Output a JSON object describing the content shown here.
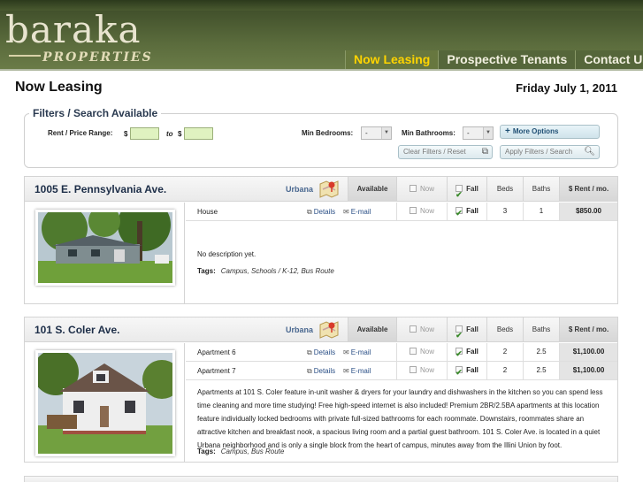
{
  "brand": {
    "logo": "baraka",
    "tagline": "PROPERTIES"
  },
  "nav": [
    {
      "label": "Now Leasing",
      "active": true
    },
    {
      "label": "Prospective Tenants",
      "active": false
    },
    {
      "label": "Contact Us",
      "active": false
    }
  ],
  "page": {
    "title": "Now Leasing",
    "date": "Friday July 1, 2011"
  },
  "filters": {
    "legend": "Filters / Search Available",
    "rent_label": "Rent / Price Range:",
    "currency": "$",
    "to": "to",
    "min_bed_label": "Min Bedrooms:",
    "min_bed_value": "-",
    "min_bath_label": "Min Bathrooms:",
    "min_bath_value": "-",
    "more_options": "More Options",
    "clear": "Clear Filters / Reset",
    "apply": "Apply Filters / Search"
  },
  "columns": {
    "available": "Available",
    "now": "Now",
    "fall": "Fall",
    "beds": "Beds",
    "baths": "Baths",
    "rent": "$ Rent / mo."
  },
  "links": {
    "details": "Details",
    "email": "E-mail"
  },
  "properties": [
    {
      "address": "1005 E. Pennsylvania Ave.",
      "city": "Urbana",
      "units": [
        {
          "name": "House",
          "now": "Now",
          "fall": "Fall",
          "beds": "3",
          "baths": "1",
          "rent": "$850.00"
        }
      ],
      "description": "No description yet.",
      "tags_label": "Tags:",
      "tags": "Campus, Schools / K-12, Bus Route"
    },
    {
      "address": "101 S. Coler Ave.",
      "city": "Urbana",
      "units": [
        {
          "name": "Apartment 6",
          "now": "Now",
          "fall": "Fall",
          "beds": "2",
          "baths": "2.5",
          "rent": "$1,100.00"
        },
        {
          "name": "Apartment 7",
          "now": "Now",
          "fall": "Fall",
          "beds": "2",
          "baths": "2.5",
          "rent": "$1,100.00"
        }
      ],
      "description": "Apartments at 101 S. Coler feature in-unit washer & dryers for your laundry and dishwashers in the kitchen so you can spend less time cleaning and more time studying! Free high-speed internet is also included! Premium 2BR/2.5BA apartments at this location feature individually locked bedrooms with private full-sized bathrooms for each roommate. Downstairs, roommates share an attractive kitchen and breakfast nook, a spacious living room and a partial guest bathroom. 101 S. Coler Ave. is located in a quiet Urbana neighborhood and is only a single block from the heart of campus, minutes away from the Illini Union by foot.",
      "tags_label": "Tags:",
      "tags": "Campus, Bus Route"
    }
  ],
  "colors": {
    "header": "#5a6b3c",
    "nav_active": "#ffd400",
    "link": "#2a4f86",
    "input_bg": "#dff2c0"
  }
}
